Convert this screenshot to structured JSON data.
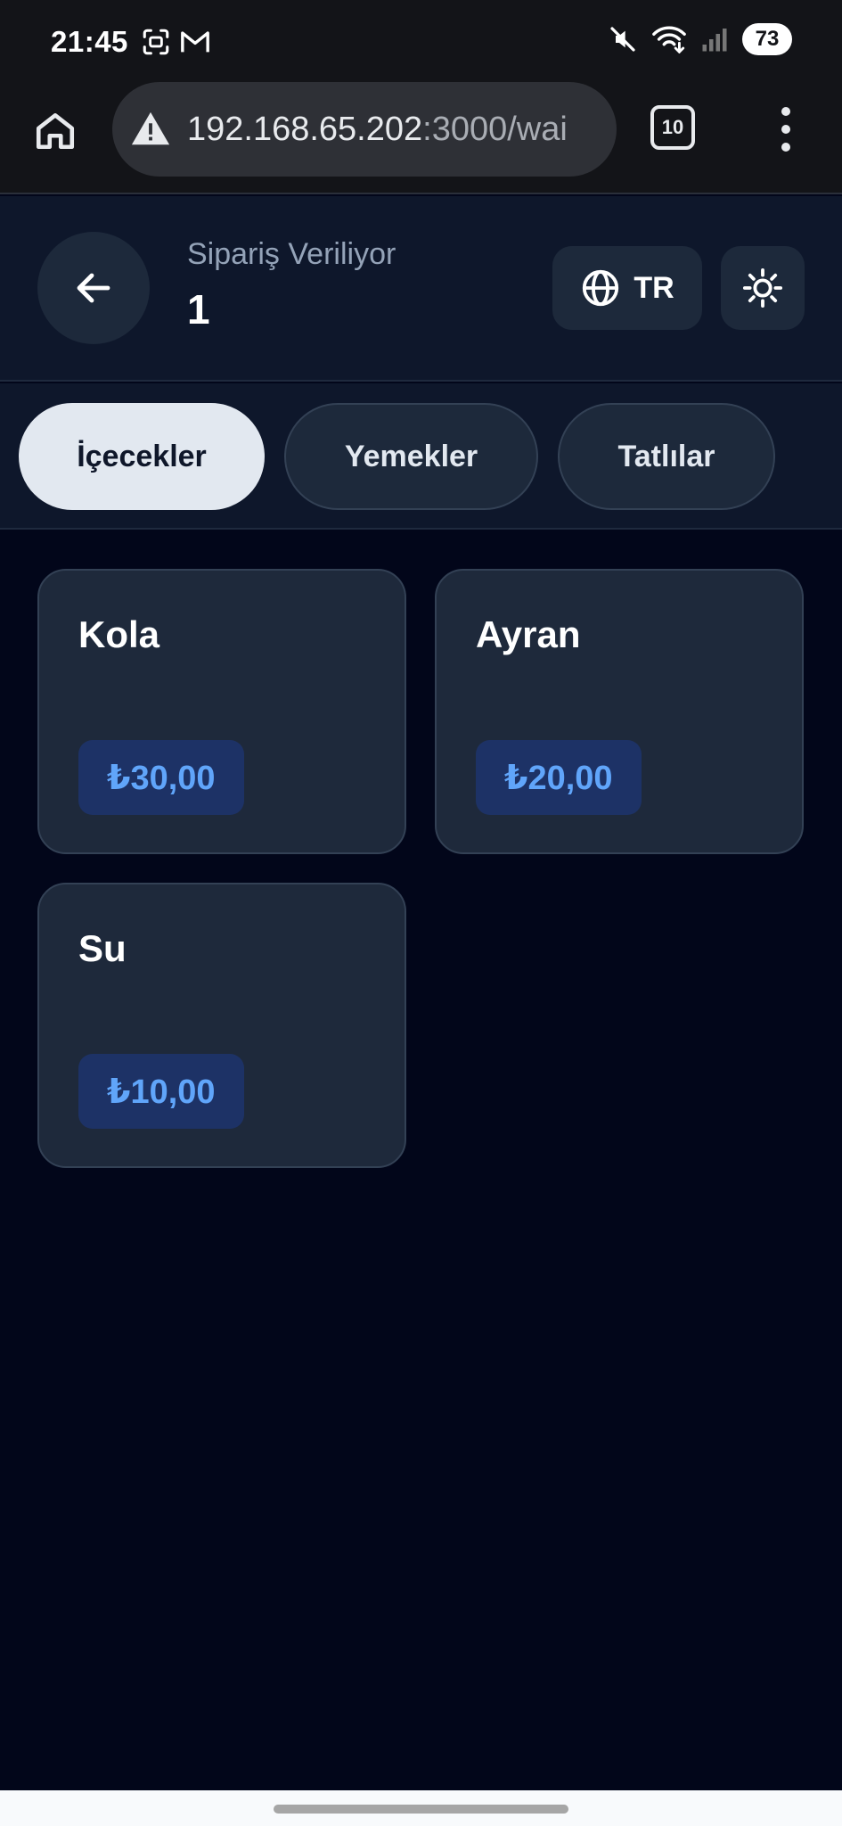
{
  "status_bar": {
    "time": "21:45",
    "battery": "73",
    "left_icons": [
      "screenshot-icon",
      "gmail-icon"
    ],
    "right_icons": [
      "mute-icon",
      "wifi-icon",
      "signal-icon"
    ]
  },
  "browser": {
    "url_host": "192.168.65.202",
    "url_path": ":3000/wai",
    "tab_count": "10",
    "icons": [
      "home-icon",
      "warning-icon",
      "tabs-icon",
      "more-vert-icon"
    ]
  },
  "header": {
    "subtitle": "Sipariş Veriliyor",
    "title": "1",
    "language": "TR",
    "icons": [
      "arrow-left-icon",
      "globe-icon",
      "sun-icon"
    ]
  },
  "tabs": [
    {
      "label": "İçecekler",
      "active": true
    },
    {
      "label": "Yemekler",
      "active": false
    },
    {
      "label": "Tatlılar",
      "active": false
    }
  ],
  "products": [
    {
      "name": "Kola",
      "price": "₺30,00"
    },
    {
      "name": "Ayran",
      "price": "₺20,00"
    },
    {
      "name": "Su",
      "price": "₺10,00"
    }
  ],
  "colors": {
    "background": "#02061a",
    "header": "#0e172b",
    "card": "#1e293b",
    "accent": "#60a5fa",
    "active_tab": "#e2e8f0"
  }
}
